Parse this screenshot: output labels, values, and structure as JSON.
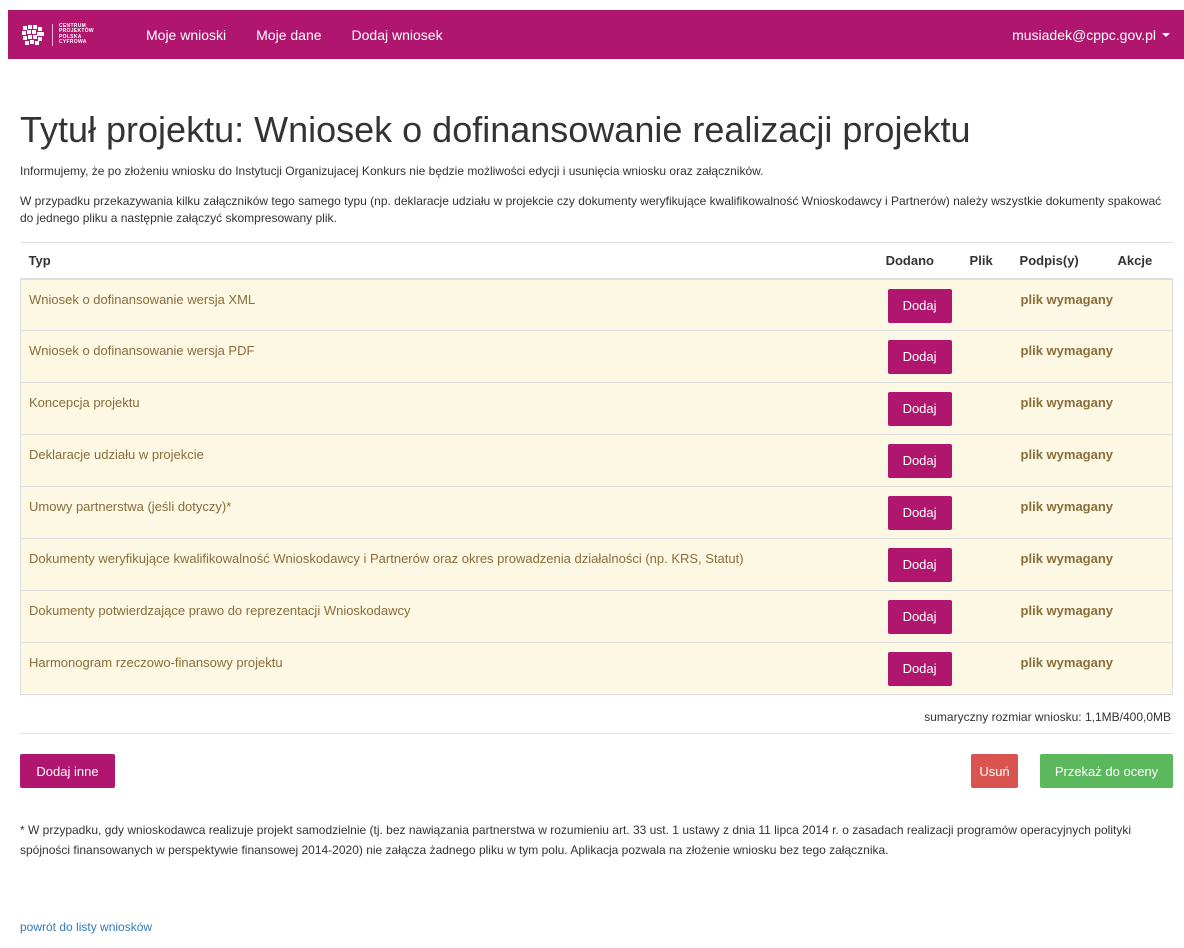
{
  "navbar": {
    "logo_lines": [
      "CENTRUM",
      "PROJEKTÓW",
      "POLSKA",
      "CYFROWA"
    ],
    "links": [
      "Moje wnioski",
      "Moje dane",
      "Dodaj wniosek"
    ],
    "user_email": "musiadek@cppc.gov.pl",
    "brand_color": "#b0166e"
  },
  "page": {
    "title": "Tytuł projektu: Wniosek o dofinansowanie realizacji projektu",
    "info1": "Informujemy, że po złożeniu wniosku do Instytucji Organizujacej Konkurs nie będzie możliwości edycji i usunięcia wniosku oraz załączników.",
    "info2": "W przypadku przekazywania kilku załączników tego samego typu (np. deklaracje udziału w projekcie czy dokumenty weryfikujące kwalifikowalność Wnioskodawcy i Partnerów) należy wszystkie dokumenty spakować do jednego pliku a następnie załączyć skompresowany plik."
  },
  "table": {
    "headers": [
      "Typ",
      "Dodano",
      "Plik",
      "Podpis(y)",
      "Akcje"
    ],
    "add_label": "Dodaj",
    "required_label": "plik wymagany",
    "rows": [
      "Wniosek o dofinansowanie wersja XML",
      "Wniosek o dofinansowanie wersja PDF",
      "Koncepcja projektu",
      "Deklaracje udziału w projekcie",
      "Umowy partnerstwa (jeśli dotyczy)*",
      "Dokumenty weryfikujące kwalifikowalność Wnioskodawcy i Partnerów oraz okres prowadzenia działalności (np. KRS, Statut)",
      "Dokumenty potwierdzające prawo do reprezentacji Wnioskodawcy",
      "Harmonogram rzeczowo-finansowy projektu"
    ]
  },
  "summary": "sumaryczny rozmiar wniosku: 1,1MB/400,0MB",
  "actions": {
    "add_other": "Dodaj inne",
    "delete": "Usuń",
    "submit": "Przekaż do oceny"
  },
  "footnote": "* W przypadku, gdy wnioskodawca realizuje projekt samodzielnie (tj. bez nawiązania partnerstwa w rozumieniu art. 33 ust. 1 ustawy z dnia 11 lipca 2014 r. o zasadach realizacji programów operacyjnych polityki spójności finansowanych w  perspektywie finansowej 2014-2020) nie załącza żadnego pliku w tym polu. Aplikacja pozwala na złożenie wniosku bez tego załącznika.",
  "back_link": "powrót do listy wniosków"
}
